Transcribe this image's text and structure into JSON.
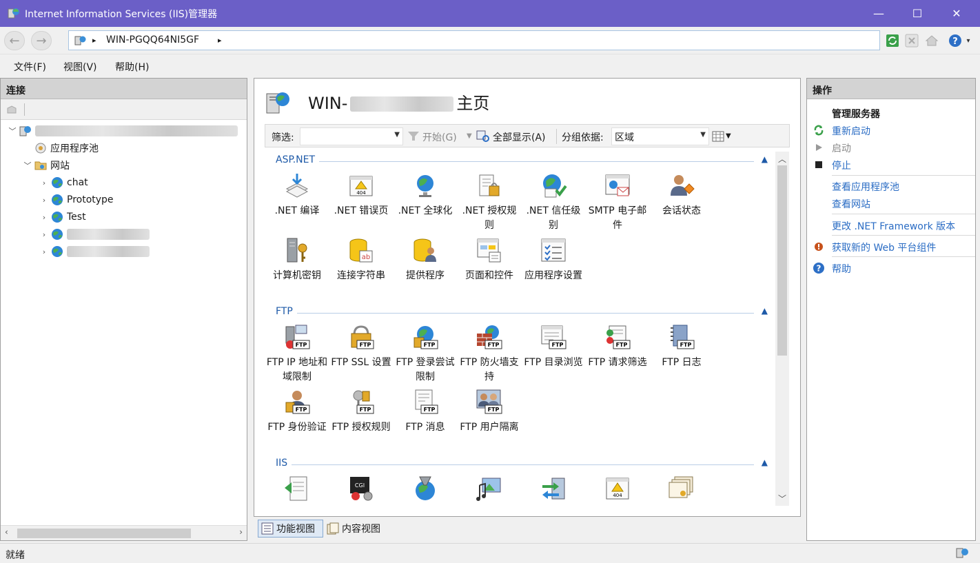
{
  "window": {
    "title": "Internet Information Services (IIS)管理器",
    "minimize": "—",
    "maximize": "☐",
    "close": "✕"
  },
  "address": {
    "separator": "▸",
    "server": "WIN-PGQQ64NI5GF",
    "trailing_arrow": "▸"
  },
  "menu": [
    "文件(F)",
    "视图(V)",
    "帮助(H)"
  ],
  "connections": {
    "header": "连接",
    "tree": {
      "app_pools": "应用程序池",
      "sites": "网站",
      "site_list": [
        "chat",
        "Prototype",
        "Test"
      ]
    }
  },
  "center": {
    "home_title_prefix": "WIN-",
    "home_title_suffix": "主页",
    "filter": {
      "label": "筛选:",
      "start": "开始(G)",
      "show_all": "全部显示(A)",
      "group_by_label": "分组依据:",
      "group_by_value": "区域"
    },
    "groups": [
      {
        "name": "ASP.NET",
        "items": [
          ".NET 编译",
          ".NET 错误页",
          ".NET 全球化",
          ".NET 授权规则",
          ".NET 信任级别",
          "SMTP 电子邮件",
          "会话状态",
          "计算机密钥",
          "连接字符串",
          "提供程序",
          "页面和控件",
          "应用程序设置"
        ]
      },
      {
        "name": "FTP",
        "items": [
          "FTP IP 地址和域限制",
          "FTP SSL 设置",
          "FTP 登录尝试限制",
          "FTP 防火墙支持",
          "FTP 目录浏览",
          "FTP 请求筛选",
          "FTP 日志",
          "FTP 身份验证",
          "FTP 授权规则",
          "FTP 消息",
          "FTP 用户隔离"
        ]
      },
      {
        "name": "IIS",
        "items": []
      }
    ],
    "view_tabs": {
      "features": "功能视图",
      "content": "内容视图"
    }
  },
  "actions": {
    "header": "操作",
    "manage_server": "管理服务器",
    "restart": "重新启动",
    "start": "启动",
    "stop": "停止",
    "view_app_pools": "查看应用程序池",
    "view_sites": "查看网站",
    "change_net_version": "更改 .NET Framework 版本",
    "get_web_platform": "获取新的 Web 平台组件",
    "help": "帮助"
  },
  "status": {
    "text": "就绪"
  },
  "colors": {
    "titlebar": "#6b5fc7",
    "link": "#2a6cc4",
    "group_header": "#1e5aa8"
  }
}
